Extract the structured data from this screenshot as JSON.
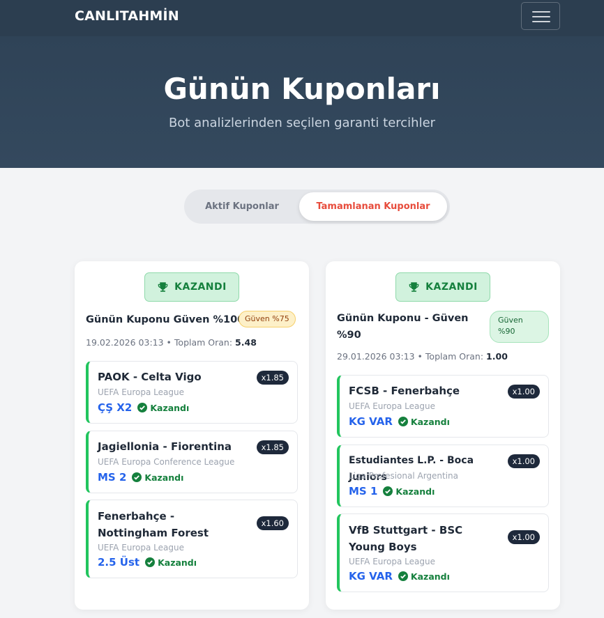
{
  "nav": {
    "brand": "CANLITAHMİN"
  },
  "hero": {
    "title": "Günün Kuponları",
    "subtitle": "Bot analizlerinden seçilen garanti tercihler"
  },
  "tabs": {
    "active": "Aktif Kuponlar",
    "completed": "Tamamlanan Kuponlar"
  },
  "coupons": [
    {
      "badge": "KAZANDI",
      "title": "Günün Kuponu Güven %100",
      "confidence": "Güven %75",
      "date": "19.02.2026 03:13",
      "total_label": "Toplam Oran:",
      "total_odds": "5.48",
      "matches": [
        {
          "name": "PAOK - Celta Vigo",
          "league": "UEFA Europa League",
          "pick": "ÇŞ X2",
          "odds": "x1.85",
          "status": "Kazandı"
        },
        {
          "name": "Jagiellonia - Fiorentina",
          "league": "UEFA Europa Conference League",
          "pick": "MS 2",
          "odds": "x1.85",
          "status": "Kazandı"
        },
        {
          "name": "Fenerbahçe - Nottingham Forest",
          "league": "UEFA Europa League",
          "pick": "2.5 Üst",
          "odds": "x1.60",
          "status": "Kazandı"
        }
      ]
    },
    {
      "badge": "KAZANDI",
      "title": "Günün Kuponu - Güven %90",
      "confidence": "Güven %90",
      "date": "29.01.2026 03:13",
      "total_label": "Toplam Oran:",
      "total_odds": "1.00",
      "matches": [
        {
          "name": "FCSB - Fenerbahçe",
          "league": "UEFA Europa League",
          "pick": "KG VAR",
          "odds": "x1.00",
          "status": "Kazandı"
        },
        {
          "name": "Estudiantes L.P. - Boca Juniors",
          "league": "Liga Profesional Argentina",
          "pick": "MS 1",
          "odds": "x1.00",
          "status": "Kazandı"
        },
        {
          "name": "VfB Stuttgart - BSC Young Boys",
          "league": "UEFA Europa League",
          "pick": "KG VAR",
          "odds": "x1.00",
          "status": "Kazandı"
        }
      ]
    }
  ],
  "colors": {
    "header": "#2c3e50",
    "accent": "#e74c3c",
    "win": "#15803d",
    "pick": "#2563eb"
  }
}
